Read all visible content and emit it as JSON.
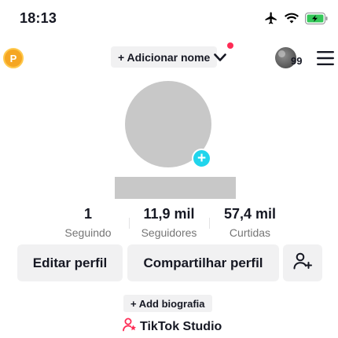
{
  "status_bar": {
    "time": "18:13",
    "icons": [
      "airplane-icon",
      "wifi-icon",
      "battery-charging-icon"
    ],
    "battery_color": "#34c759"
  },
  "header": {
    "coin_label": "P",
    "add_name_label": "+ Adicionar nome",
    "avatar_badge": "99",
    "notification_dot_color": "#fe2c55"
  },
  "profile": {
    "add_photo_label": "+"
  },
  "stats": [
    {
      "value": "1",
      "label": "Seguindo"
    },
    {
      "value": "11,9 mil",
      "label": "Seguidores"
    },
    {
      "value": "57,4 mil",
      "label": "Curtidas"
    }
  ],
  "buttons": {
    "edit_profile": "Editar perfil",
    "share_profile": "Compartilhar perfil"
  },
  "bio": {
    "add_label": "+ Add biografia"
  },
  "studio": {
    "label": "TikTok Studio",
    "icon_color": "#fe2c55"
  }
}
